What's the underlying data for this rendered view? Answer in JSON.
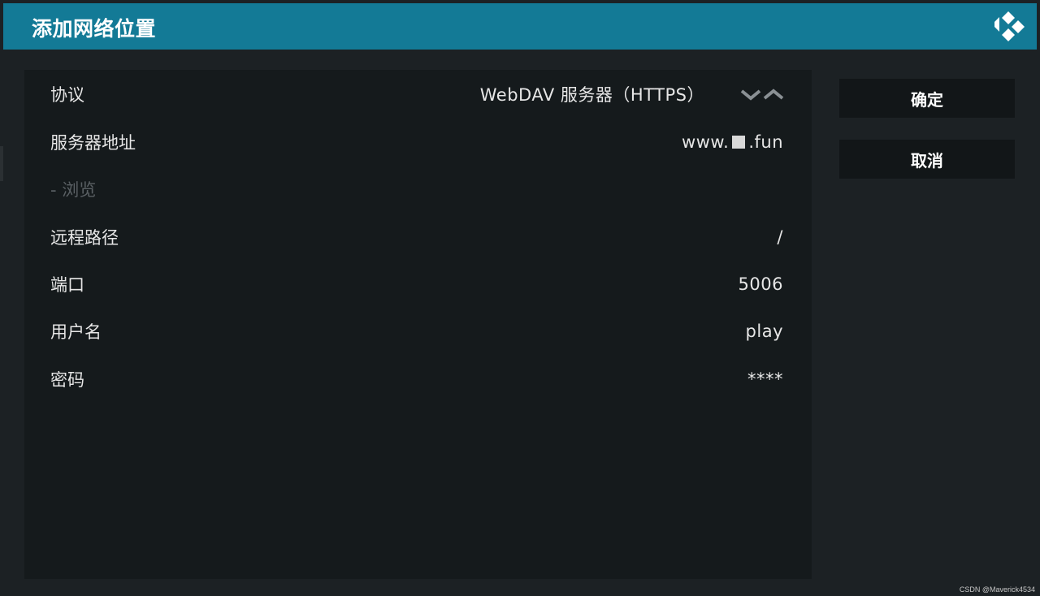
{
  "dialog": {
    "title": "添加网络位置"
  },
  "fields": [
    {
      "label": "协议",
      "value": "WebDAV 服务器（HTTPS）",
      "disabled": false
    },
    {
      "label": "服务器地址",
      "value_prefix": "www.",
      "value_suffix": ".fun",
      "disabled": false
    },
    {
      "label": "- 浏览",
      "value": "",
      "disabled": true
    },
    {
      "label": "远程路径",
      "value": "/",
      "disabled": false
    },
    {
      "label": "端口",
      "value": "5006",
      "disabled": false
    },
    {
      "label": "用户名",
      "value": "play",
      "disabled": false
    },
    {
      "label": "密码",
      "value": "****",
      "disabled": false
    }
  ],
  "buttons": {
    "ok_label": "确定",
    "cancel_label": "取消"
  },
  "icons": {
    "logo": "kodi-logo-icon",
    "spinner_down": "chevron-down-icon",
    "spinner_up": "chevron-up-icon"
  },
  "colors": {
    "header": "#137a96",
    "panel": "#151a1c",
    "background": "#1c2124",
    "button": "#121618",
    "text": "#e6e6e6",
    "disabled_text": "#5a6064"
  },
  "watermark": "CSDN @Maverick4534"
}
